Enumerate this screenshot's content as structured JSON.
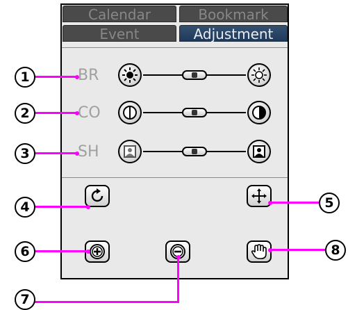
{
  "tabs": {
    "calendar": "Calendar",
    "bookmark": "Bookmark",
    "event": "Event",
    "adjustment": "Adjustment"
  },
  "adjustments": {
    "brightness": {
      "label": "BR",
      "level": 0.5
    },
    "contrast": {
      "label": "CO",
      "level": 0.5
    },
    "sharpness": {
      "label": "SH",
      "level": 0.5
    }
  },
  "callouts": [
    "1",
    "2",
    "3",
    "4",
    "5",
    "6",
    "7",
    "8"
  ],
  "icons": {
    "br_low": "sun-dim-icon",
    "br_high": "sun-bright-icon",
    "co_low": "contrast-low-icon",
    "co_high": "contrast-high-icon",
    "sh_low": "picture-soft-icon",
    "sh_high": "picture-sharp-icon",
    "rotate": "rotate-icon",
    "move": "move-arrows-icon",
    "zoom_in": "zoom-in-icon",
    "zoom_out": "zoom-out-icon",
    "pan": "hand-icon"
  },
  "colors": {
    "callout_line": "#ff00ff",
    "active_tab": "#2b4666",
    "inactive_tab": "#4a4a4a",
    "panel_bg": "#e9e9e9",
    "label_text": "#a0a0a0"
  }
}
